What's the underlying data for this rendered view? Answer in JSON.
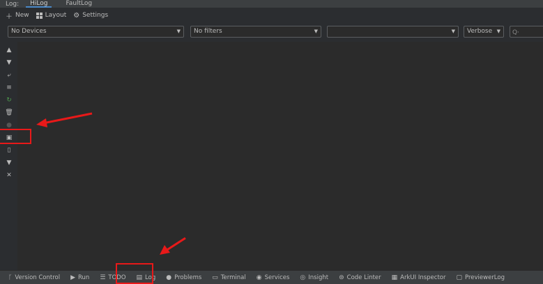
{
  "tabs_bar": {
    "label": "Log:",
    "tabs": [
      {
        "label": "HiLog",
        "active": true
      },
      {
        "label": "FaultLog",
        "active": false
      }
    ]
  },
  "toolbar": {
    "new_label": "New",
    "layout_label": "Layout",
    "settings_label": "Settings"
  },
  "filters": {
    "device_value": "No Devices",
    "filter_value": "No filters",
    "app_value": "",
    "level_value": "Verbose",
    "search_placeholder": ""
  },
  "left_tools": [
    {
      "name": "scroll-up-icon"
    },
    {
      "name": "scroll-down-icon"
    },
    {
      "name": "soft-wrap-icon"
    },
    {
      "name": "scroll-to-end-icon"
    },
    {
      "name": "restart-icon"
    },
    {
      "name": "clear-icon"
    },
    {
      "name": "camera-icon"
    },
    {
      "name": "save-icon"
    },
    {
      "name": "device-icon"
    },
    {
      "name": "filter-icon"
    },
    {
      "name": "close-icon"
    }
  ],
  "bottom_tools": [
    {
      "label": "Version Control",
      "icon": "branch-icon"
    },
    {
      "label": "Run",
      "icon": "play-icon"
    },
    {
      "label": "TODO",
      "icon": "list-icon"
    },
    {
      "label": "Log",
      "icon": "log-icon"
    },
    {
      "label": "Problems",
      "icon": "info-icon"
    },
    {
      "label": "Terminal",
      "icon": "terminal-icon"
    },
    {
      "label": "Services",
      "icon": "services-icon"
    },
    {
      "label": "Insight",
      "icon": "insight-icon"
    },
    {
      "label": "Code Linter",
      "icon": "linter-icon"
    },
    {
      "label": "ArkUI Inspector",
      "icon": "inspector-icon"
    },
    {
      "label": "PreviewerLog",
      "icon": "previewer-icon"
    }
  ],
  "colors": {
    "highlight": "#e81919",
    "accent": "#4a88c7"
  }
}
